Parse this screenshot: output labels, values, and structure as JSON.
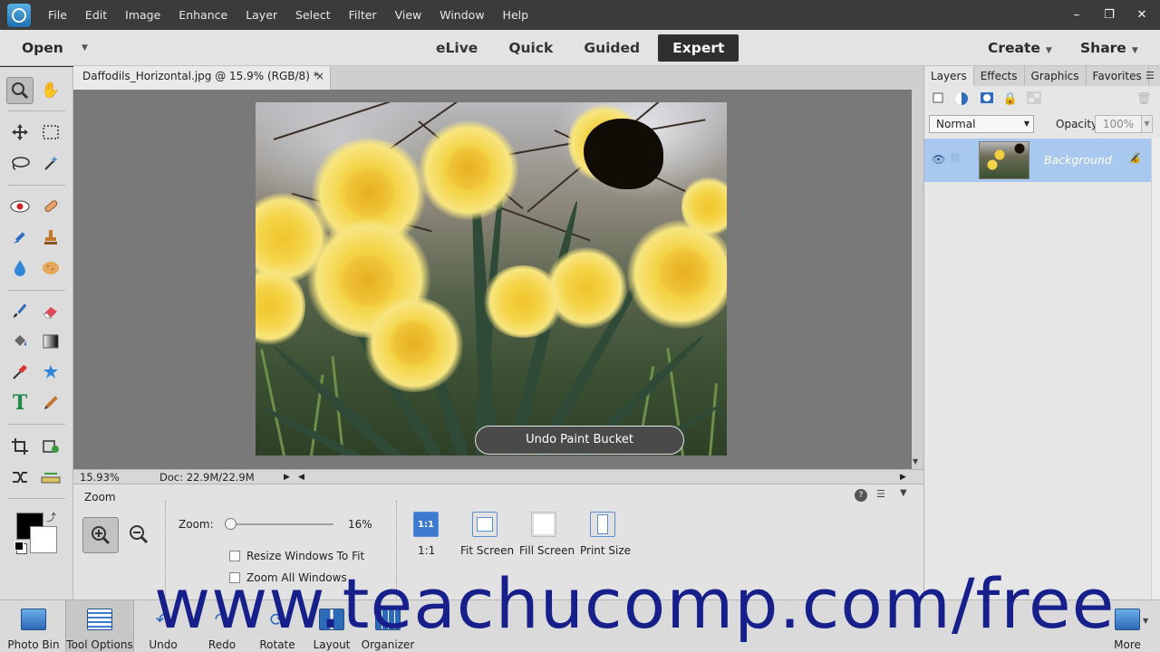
{
  "menubar": {
    "items": [
      "File",
      "Edit",
      "Image",
      "Enhance",
      "Layer",
      "Select",
      "Filter",
      "View",
      "Window",
      "Help"
    ],
    "minimize": "–",
    "restore": "❐",
    "close": "✕"
  },
  "modebar": {
    "open": "Open",
    "tabs": [
      "eLive",
      "Quick",
      "Guided",
      "Expert"
    ],
    "active_tab": "Expert",
    "create": "Create",
    "share": "Share"
  },
  "toolbox": {
    "foreground_color": "#000000",
    "background_color": "#ffffff"
  },
  "document": {
    "tab_title": "Daffodils_Horizontal.jpg @ 15.9% (RGB/8) *",
    "close_label": "×",
    "status_zoom": "15.93%",
    "status_doc": "Doc: 22.9M/22.9M",
    "toast": "Undo Paint Bucket"
  },
  "layers_panel": {
    "tabs": [
      "Layers",
      "Effects",
      "Graphics",
      "Favorites"
    ],
    "active_tab": "Layers",
    "blend_mode": "Normal",
    "opacity_label": "Opacity:",
    "opacity_value": "100%",
    "layer_name": "Background"
  },
  "tool_options": {
    "title": "Zoom",
    "help": "?",
    "zoom_label": "Zoom:",
    "zoom_value": "16%",
    "zoom_slider_fraction": 0.16,
    "resize_windows": "Resize Windows To Fit",
    "zoom_all_windows": "Zoom All Windows",
    "view_buttons": [
      {
        "label": "1:1",
        "icon": "1:1"
      },
      {
        "label": "Fit Screen",
        "icon": ""
      },
      {
        "label": "Fill Screen",
        "icon": ""
      },
      {
        "label": "Print Size",
        "icon": ""
      }
    ]
  },
  "bottom_bar": {
    "items": [
      "Photo Bin",
      "Tool Options",
      "Undo",
      "Redo",
      "Rotate",
      "Layout",
      "Organizer"
    ],
    "more": "More"
  },
  "watermark": "www.teachucomp.com/free",
  "colors": {
    "accent": "#5a8fd0",
    "selected_layer": "#a9c8ef",
    "watermark": "#171f8a"
  }
}
